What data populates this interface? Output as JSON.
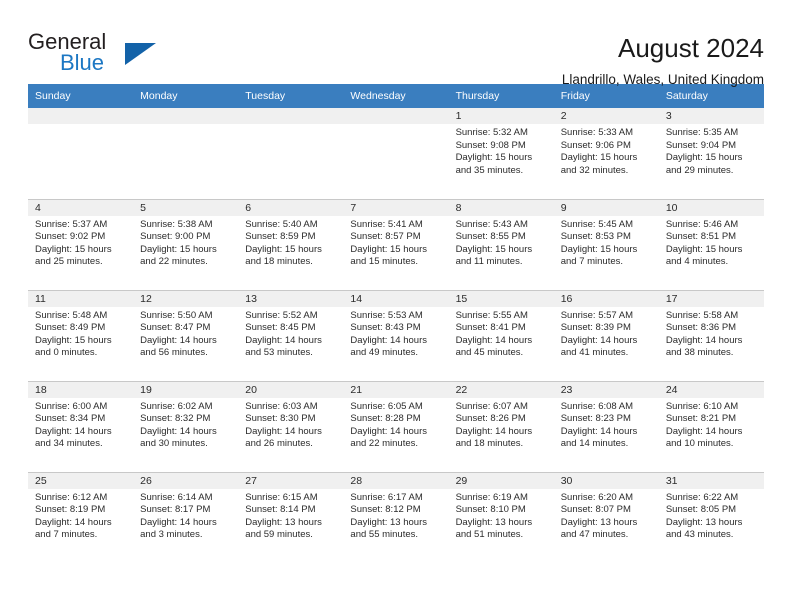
{
  "brand": {
    "name_part1": "General",
    "name_part2": "Blue",
    "logo_icon": "triangle-logo-icon",
    "accent_color": "#1c77c3"
  },
  "header": {
    "title": "August 2024",
    "subtitle": "Llandrillo, Wales, United Kingdom"
  },
  "calendar": {
    "header_bg": "#3a7ebf",
    "daynum_bg": "#f0f0f0",
    "weekdays": [
      "Sunday",
      "Monday",
      "Tuesday",
      "Wednesday",
      "Thursday",
      "Friday",
      "Saturday"
    ],
    "labels": {
      "sunrise": "Sunrise:",
      "sunset": "Sunset:",
      "daylight": "Daylight:"
    },
    "weeks": [
      [
        {
          "day": "",
          "empty": true
        },
        {
          "day": "",
          "empty": true
        },
        {
          "day": "",
          "empty": true
        },
        {
          "day": "",
          "empty": true
        },
        {
          "day": "1",
          "sunrise": "Sunrise: 5:32 AM",
          "sunset": "Sunset: 9:08 PM",
          "daylight_l1": "Daylight: 15 hours",
          "daylight_l2": "and 35 minutes."
        },
        {
          "day": "2",
          "sunrise": "Sunrise: 5:33 AM",
          "sunset": "Sunset: 9:06 PM",
          "daylight_l1": "Daylight: 15 hours",
          "daylight_l2": "and 32 minutes."
        },
        {
          "day": "3",
          "sunrise": "Sunrise: 5:35 AM",
          "sunset": "Sunset: 9:04 PM",
          "daylight_l1": "Daylight: 15 hours",
          "daylight_l2": "and 29 minutes."
        }
      ],
      [
        {
          "day": "4",
          "sunrise": "Sunrise: 5:37 AM",
          "sunset": "Sunset: 9:02 PM",
          "daylight_l1": "Daylight: 15 hours",
          "daylight_l2": "and 25 minutes."
        },
        {
          "day": "5",
          "sunrise": "Sunrise: 5:38 AM",
          "sunset": "Sunset: 9:00 PM",
          "daylight_l1": "Daylight: 15 hours",
          "daylight_l2": "and 22 minutes."
        },
        {
          "day": "6",
          "sunrise": "Sunrise: 5:40 AM",
          "sunset": "Sunset: 8:59 PM",
          "daylight_l1": "Daylight: 15 hours",
          "daylight_l2": "and 18 minutes."
        },
        {
          "day": "7",
          "sunrise": "Sunrise: 5:41 AM",
          "sunset": "Sunset: 8:57 PM",
          "daylight_l1": "Daylight: 15 hours",
          "daylight_l2": "and 15 minutes."
        },
        {
          "day": "8",
          "sunrise": "Sunrise: 5:43 AM",
          "sunset": "Sunset: 8:55 PM",
          "daylight_l1": "Daylight: 15 hours",
          "daylight_l2": "and 11 minutes."
        },
        {
          "day": "9",
          "sunrise": "Sunrise: 5:45 AM",
          "sunset": "Sunset: 8:53 PM",
          "daylight_l1": "Daylight: 15 hours",
          "daylight_l2": "and 7 minutes."
        },
        {
          "day": "10",
          "sunrise": "Sunrise: 5:46 AM",
          "sunset": "Sunset: 8:51 PM",
          "daylight_l1": "Daylight: 15 hours",
          "daylight_l2": "and 4 minutes."
        }
      ],
      [
        {
          "day": "11",
          "sunrise": "Sunrise: 5:48 AM",
          "sunset": "Sunset: 8:49 PM",
          "daylight_l1": "Daylight: 15 hours",
          "daylight_l2": "and 0 minutes."
        },
        {
          "day": "12",
          "sunrise": "Sunrise: 5:50 AM",
          "sunset": "Sunset: 8:47 PM",
          "daylight_l1": "Daylight: 14 hours",
          "daylight_l2": "and 56 minutes."
        },
        {
          "day": "13",
          "sunrise": "Sunrise: 5:52 AM",
          "sunset": "Sunset: 8:45 PM",
          "daylight_l1": "Daylight: 14 hours",
          "daylight_l2": "and 53 minutes."
        },
        {
          "day": "14",
          "sunrise": "Sunrise: 5:53 AM",
          "sunset": "Sunset: 8:43 PM",
          "daylight_l1": "Daylight: 14 hours",
          "daylight_l2": "and 49 minutes."
        },
        {
          "day": "15",
          "sunrise": "Sunrise: 5:55 AM",
          "sunset": "Sunset: 8:41 PM",
          "daylight_l1": "Daylight: 14 hours",
          "daylight_l2": "and 45 minutes."
        },
        {
          "day": "16",
          "sunrise": "Sunrise: 5:57 AM",
          "sunset": "Sunset: 8:39 PM",
          "daylight_l1": "Daylight: 14 hours",
          "daylight_l2": "and 41 minutes."
        },
        {
          "day": "17",
          "sunrise": "Sunrise: 5:58 AM",
          "sunset": "Sunset: 8:36 PM",
          "daylight_l1": "Daylight: 14 hours",
          "daylight_l2": "and 38 minutes."
        }
      ],
      [
        {
          "day": "18",
          "sunrise": "Sunrise: 6:00 AM",
          "sunset": "Sunset: 8:34 PM",
          "daylight_l1": "Daylight: 14 hours",
          "daylight_l2": "and 34 minutes."
        },
        {
          "day": "19",
          "sunrise": "Sunrise: 6:02 AM",
          "sunset": "Sunset: 8:32 PM",
          "daylight_l1": "Daylight: 14 hours",
          "daylight_l2": "and 30 minutes."
        },
        {
          "day": "20",
          "sunrise": "Sunrise: 6:03 AM",
          "sunset": "Sunset: 8:30 PM",
          "daylight_l1": "Daylight: 14 hours",
          "daylight_l2": "and 26 minutes."
        },
        {
          "day": "21",
          "sunrise": "Sunrise: 6:05 AM",
          "sunset": "Sunset: 8:28 PM",
          "daylight_l1": "Daylight: 14 hours",
          "daylight_l2": "and 22 minutes."
        },
        {
          "day": "22",
          "sunrise": "Sunrise: 6:07 AM",
          "sunset": "Sunset: 8:26 PM",
          "daylight_l1": "Daylight: 14 hours",
          "daylight_l2": "and 18 minutes."
        },
        {
          "day": "23",
          "sunrise": "Sunrise: 6:08 AM",
          "sunset": "Sunset: 8:23 PM",
          "daylight_l1": "Daylight: 14 hours",
          "daylight_l2": "and 14 minutes."
        },
        {
          "day": "24",
          "sunrise": "Sunrise: 6:10 AM",
          "sunset": "Sunset: 8:21 PM",
          "daylight_l1": "Daylight: 14 hours",
          "daylight_l2": "and 10 minutes."
        }
      ],
      [
        {
          "day": "25",
          "sunrise": "Sunrise: 6:12 AM",
          "sunset": "Sunset: 8:19 PM",
          "daylight_l1": "Daylight: 14 hours",
          "daylight_l2": "and 7 minutes."
        },
        {
          "day": "26",
          "sunrise": "Sunrise: 6:14 AM",
          "sunset": "Sunset: 8:17 PM",
          "daylight_l1": "Daylight: 14 hours",
          "daylight_l2": "and 3 minutes."
        },
        {
          "day": "27",
          "sunrise": "Sunrise: 6:15 AM",
          "sunset": "Sunset: 8:14 PM",
          "daylight_l1": "Daylight: 13 hours",
          "daylight_l2": "and 59 minutes."
        },
        {
          "day": "28",
          "sunrise": "Sunrise: 6:17 AM",
          "sunset": "Sunset: 8:12 PM",
          "daylight_l1": "Daylight: 13 hours",
          "daylight_l2": "and 55 minutes."
        },
        {
          "day": "29",
          "sunrise": "Sunrise: 6:19 AM",
          "sunset": "Sunset: 8:10 PM",
          "daylight_l1": "Daylight: 13 hours",
          "daylight_l2": "and 51 minutes."
        },
        {
          "day": "30",
          "sunrise": "Sunrise: 6:20 AM",
          "sunset": "Sunset: 8:07 PM",
          "daylight_l1": "Daylight: 13 hours",
          "daylight_l2": "and 47 minutes."
        },
        {
          "day": "31",
          "sunrise": "Sunrise: 6:22 AM",
          "sunset": "Sunset: 8:05 PM",
          "daylight_l1": "Daylight: 13 hours",
          "daylight_l2": "and 43 minutes."
        }
      ]
    ]
  }
}
